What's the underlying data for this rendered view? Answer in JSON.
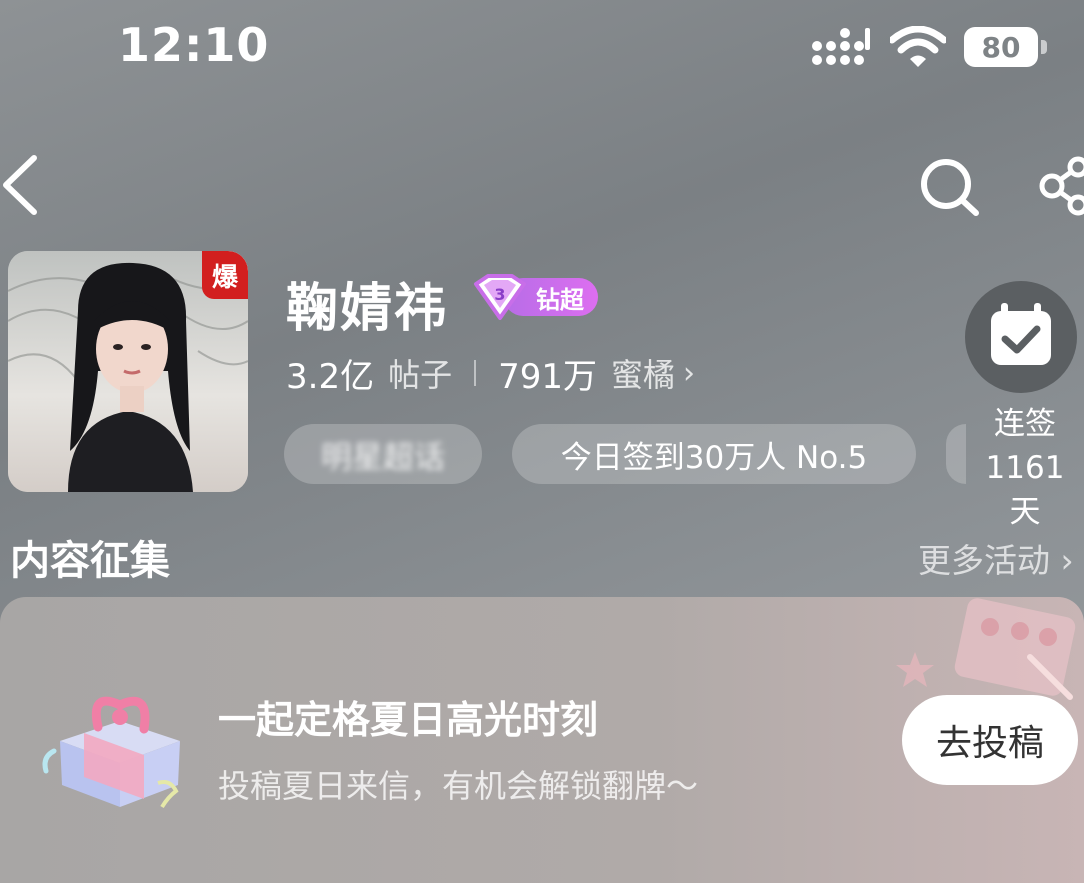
{
  "status_bar": {
    "time": "12:10",
    "battery": "80"
  },
  "profile": {
    "hot_badge": "爆",
    "name": "鞠婧祎",
    "level_badge": "钻超",
    "posts_count": "3.2亿",
    "posts_label": "帖子",
    "fans_count": "791万",
    "fans_label": "蜜橘",
    "tags": [
      "明星超话",
      "今日签到30万人 No.5"
    ],
    "checkin_label": "连签",
    "checkin_days": "1161天"
  },
  "section": {
    "title": "内容征集",
    "more": "更多活动 ›"
  },
  "campaign": {
    "title": "一起定格夏日高光时刻",
    "subtitle": "投稿夏日来信，有机会解锁翻牌～",
    "button": "去投稿"
  },
  "colors": {
    "background": "#868b8e",
    "hot_badge": "#d21f1f",
    "level_badge": "#c86ee9"
  },
  "icons": [
    "back-arrow-icon",
    "search-icon",
    "share-icon",
    "calendar-check-icon",
    "gift-icon",
    "diamond-icon"
  ]
}
